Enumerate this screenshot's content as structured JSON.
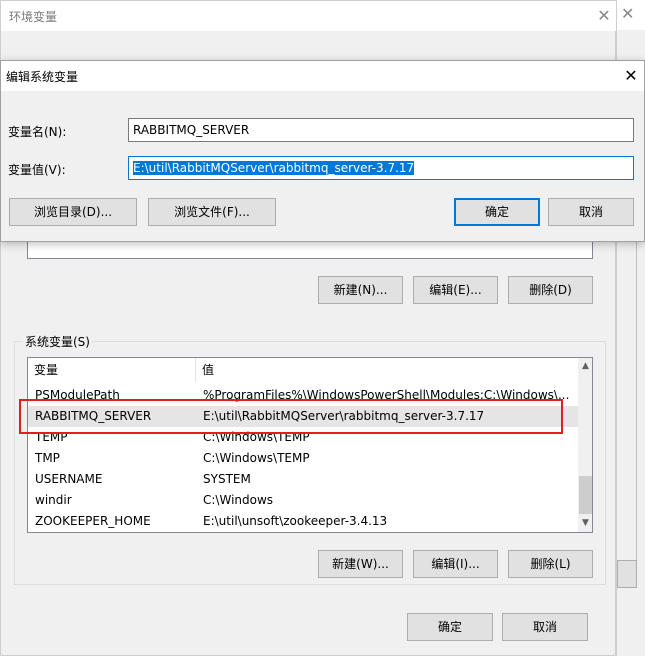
{
  "background_window": {
    "title": "环境变量",
    "close_glyph": "✕"
  },
  "right_window": {
    "close_glyph": "✕"
  },
  "user_vars": {
    "buttons": {
      "new": "新建(N)...",
      "edit": "编辑(E)...",
      "delete": "删除(D)"
    }
  },
  "system_vars": {
    "group_label": "系统变量(S)",
    "columns": {
      "name": "变量",
      "value": "值"
    },
    "rows": [
      {
        "name": "PSModulePath",
        "value": "%ProgramFiles%\\WindowsPowerShell\\Modules;C:\\Windows\\..."
      },
      {
        "name": "RABBITMQ_SERVER",
        "value": "E:\\util\\RabbitMQServer\\rabbitmq_server-3.7.17"
      },
      {
        "name": "TEMP",
        "value": "C:\\Windows\\TEMP"
      },
      {
        "name": "TMP",
        "value": "C:\\Windows\\TEMP"
      },
      {
        "name": "USERNAME",
        "value": "SYSTEM"
      },
      {
        "name": "windir",
        "value": "C:\\Windows"
      },
      {
        "name": "ZOOKEEPER_HOME",
        "value": "E:\\util\\unsoft\\zookeeper-3.4.13"
      }
    ],
    "selected_row": "RABBITMQ_SERVER",
    "buttons": {
      "new": "新建(W)...",
      "edit": "编辑(I)...",
      "delete": "删除(L)"
    },
    "scroll_up_glyph": "▲",
    "scroll_down_glyph": "▼"
  },
  "footer": {
    "ok": "确定",
    "cancel": "取消"
  },
  "edit_dialog": {
    "title": "编辑系统变量",
    "close_glyph": "✕",
    "name_label": "变量名(N):",
    "name_value": "RABBITMQ_SERVER",
    "value_label": "变量值(V):",
    "value_value": "E:\\util\\RabbitMQServer\\rabbitmq_server-3.7.17",
    "browse_dir": "浏览目录(D)...",
    "browse_file": "浏览文件(F)...",
    "ok": "确定",
    "cancel": "取消"
  },
  "colors": {
    "highlight_border": "#e02020",
    "focus_blue": "#0078d7",
    "selection_gray": "#e5e5e5"
  }
}
